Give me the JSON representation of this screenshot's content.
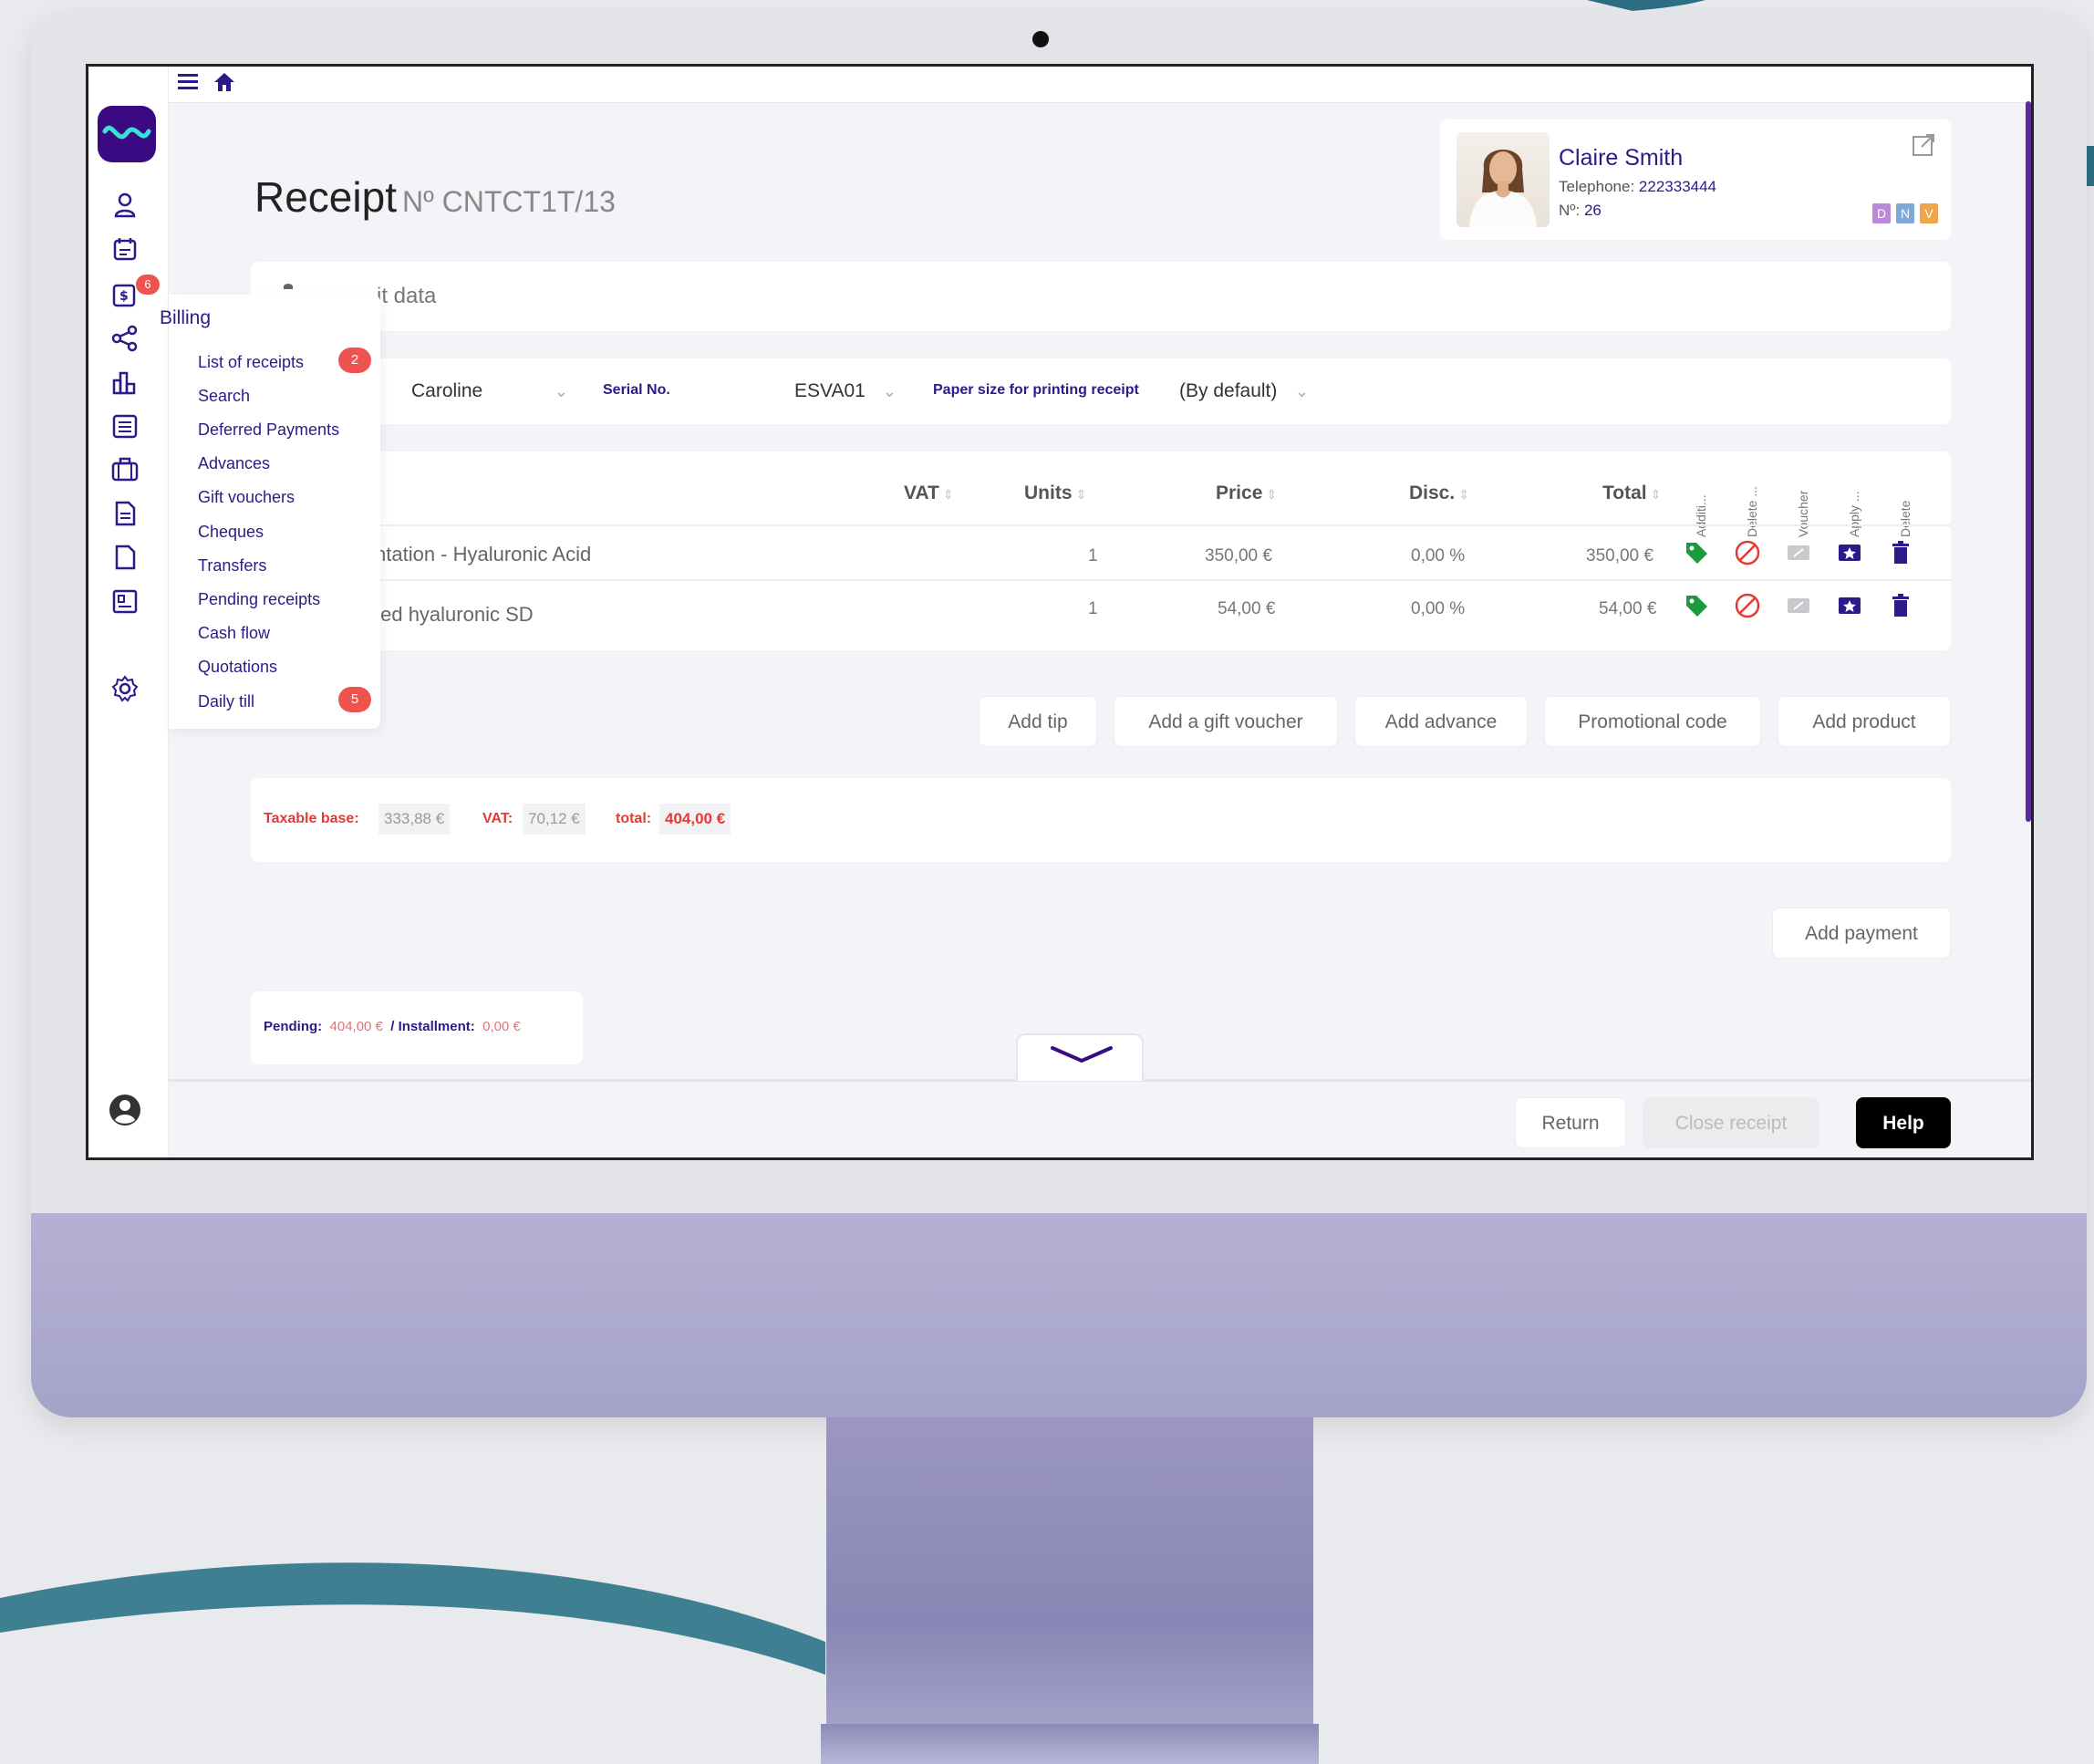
{
  "topbar": {
    "menu_icon": "hamburger-icon",
    "home_icon": "home-icon"
  },
  "sidebar": {
    "icons": [
      "user-icon",
      "calendar-icon",
      "billing-icon",
      "share-icon",
      "chart-icon",
      "checklist-icon",
      "briefcase-icon",
      "document-icon",
      "file-icon",
      "list-icon",
      "settings-icon"
    ],
    "billing_badge": "6"
  },
  "billing_menu": {
    "title": "Billing",
    "items": [
      {
        "label": "List of receipts",
        "badge": "2"
      },
      {
        "label": "Search"
      },
      {
        "label": "Deferred Payments"
      },
      {
        "label": "Advances"
      },
      {
        "label": "Gift vouchers"
      },
      {
        "label": "Cheques"
      },
      {
        "label": "Transfers"
      },
      {
        "label": "Pending receipts"
      },
      {
        "label": "Cash flow"
      },
      {
        "label": "Quotations"
      },
      {
        "label": "Daily till",
        "badge": "5"
      }
    ]
  },
  "page": {
    "title": "Receipt",
    "number": "Nº CNTCT1T/13"
  },
  "client": {
    "name": "Claire Smith",
    "phone_label": "Telephone:",
    "phone": "222333444",
    "number_label": "Nº:",
    "number": "26",
    "tags": [
      {
        "t": "D",
        "color": "#b98ad6"
      },
      {
        "t": "N",
        "color": "#7fa7d9"
      },
      {
        "t": "V",
        "color": "#f0a54a"
      }
    ]
  },
  "section": {
    "label": "it data"
  },
  "filters": {
    "employee": "Caroline",
    "serial_label": "Serial No.",
    "serial": "ESVA01",
    "paper_label": "Paper size for printing receipt",
    "paper": "(By default)"
  },
  "table": {
    "headers": {
      "vat": "VAT",
      "units": "Units",
      "price": "Price",
      "disc": "Disc.",
      "total": "Total"
    },
    "vertical_headers": [
      "Additi...",
      "Delete ...",
      "Voucher",
      "Apply ...",
      "Delete"
    ],
    "rows": [
      {
        "desc": "ntation - Hyaluronic Acid",
        "units": "1",
        "price": "350,00 €",
        "disc": "0,00 %",
        "total": "350,00 €"
      },
      {
        "desc": "ted hyaluronic SD",
        "units": "1",
        "price": "54,00 €",
        "disc": "0,00 %",
        "total": "54,00 €"
      }
    ]
  },
  "actions": {
    "add_tip": "Add tip",
    "add_gift": "Add a gift voucher",
    "add_advance": "Add advance",
    "promo": "Promotional code",
    "add_product": "Add product"
  },
  "totals": {
    "base_label": "Taxable base:",
    "base": "333,88 €",
    "vat_label": "VAT:",
    "vat": "70,12 €",
    "total_label": "total:",
    "total": "404,00 €"
  },
  "payment": {
    "add_payment": "Add payment"
  },
  "pending": {
    "pending_label": "Pending:",
    "pending": "404,00 €",
    "inst_label": "/ Installment:",
    "installment": "0,00 €"
  },
  "footer": {
    "return": "Return",
    "close": "Close receipt",
    "help": "Help"
  },
  "colors": {
    "accent": "#2c1a8a",
    "danger": "#e53935",
    "green": "#1a9b3c"
  }
}
